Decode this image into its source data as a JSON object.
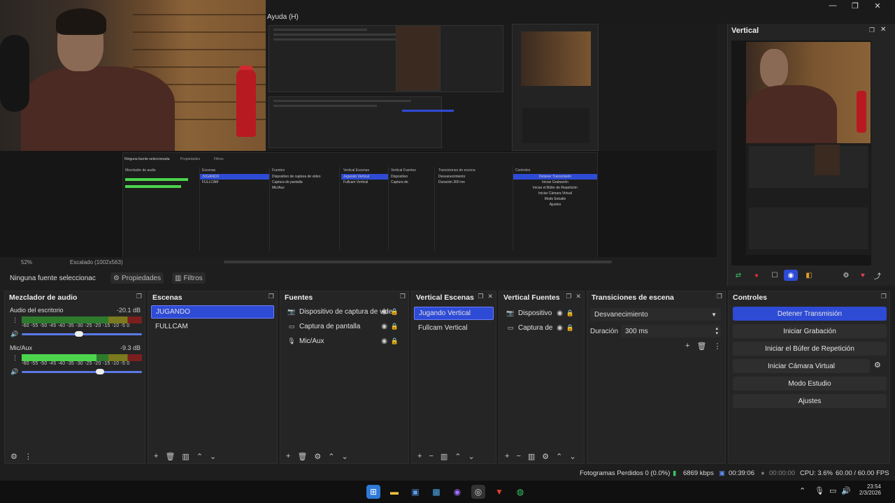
{
  "window": {
    "minimize": "—",
    "maximize": "❐",
    "close": "✕",
    "menu_help": "Ayuda (H)"
  },
  "preview": {
    "zoom": "52%",
    "scale_label": "Escalado (1002x563)",
    "nested": {
      "mixer_title": "Mezclador de audio",
      "scenes_title": "Escenas",
      "sources_title": "Fuentes",
      "vscenes_title": "Vertical Escenas",
      "vsources_title": "Vertical Fuentes",
      "transitions_title": "Transiciones de escena",
      "controls_title": "Controles",
      "scene_a": "JUGANDO",
      "scene_b": "FULLCAM",
      "no_source": "Ninguna fuente seleccionada",
      "props": "Propiedades",
      "filters": "Filtros",
      "src_a": "Dispositivo de captura de video",
      "src_b": "Captura de pantalla",
      "src_c": "Mic/Aux",
      "vscene_a": "Jugando Vertical",
      "vscene_b": "Fullcam Vertical",
      "vsrc_a": "Dispositivo",
      "vsrc_b": "Captura de",
      "transition": "Desvanecimiento",
      "duration_label": "Duración",
      "duration": "300 ms",
      "ctl_1": "Detener Transmisión",
      "ctl_2": "Iniciar Grabación",
      "ctl_3": "Iniciar el Búfer de Repetición",
      "ctl_4": "Iniciar Cámara Virtual",
      "ctl_5": "Modo Estudio",
      "ctl_6": "Ajustes"
    }
  },
  "vertical_dock": {
    "title": "Vertical"
  },
  "properties_bar": {
    "no_source": "Ninguna fuente seleccionac",
    "properties": "Propiedades",
    "filters": "Filtros"
  },
  "mixer": {
    "title": "Mezclador de audio",
    "channels": [
      {
        "name": "Audio del escritorio",
        "db": "-20.1 dB",
        "level": 0.0
      },
      {
        "name": "Mic/Aux",
        "db": "-9.3 dB",
        "level": 0.62
      }
    ],
    "ticks": "-60 -55 -50 -45 -40 -35 -30 -25 -20 -15 -10 -5 0"
  },
  "scenes": {
    "title": "Escenas",
    "items": [
      "JUGANDO",
      "FULLCAM"
    ]
  },
  "sources": {
    "title": "Fuentes",
    "items": [
      "Dispositivo de captura de vide",
      "Captura de pantalla",
      "Mic/Aux"
    ]
  },
  "vertical_scenes": {
    "title": "Vertical Escenas",
    "items": [
      "Jugando Vertical",
      "Fullcam Vertical"
    ]
  },
  "vertical_sources": {
    "title": "Vertical Fuentes",
    "items": [
      "Dispositivo",
      "Captura de"
    ]
  },
  "transitions": {
    "title": "Transiciones de escena",
    "selected": "Desvanecimiento",
    "duration_label": "Duración",
    "duration_value": "300 ms"
  },
  "controls": {
    "title": "Controles",
    "buttons": [
      "Detener Transmisión",
      "Iniciar Grabación",
      "Iniciar el Búfer de Repetición",
      "Iniciar Cámara Virtual",
      "Modo Estudio",
      "Ajustes"
    ]
  },
  "status": {
    "dropped_frames": "Fotogramas Perdidos 0 (0.0%)",
    "bitrate": "6869 kbps",
    "stream_time": "00:39:06",
    "rec_time": "00:00:00",
    "cpu": "CPU: 3.6%",
    "fps": "60.00 / 60.00 FPS"
  },
  "taskbar": {
    "time": "23:54",
    "date": "2/3/2026"
  },
  "colors": {
    "accent": "#2e4bd6",
    "panel": "#252525",
    "meter_green": "#4cd44c"
  }
}
